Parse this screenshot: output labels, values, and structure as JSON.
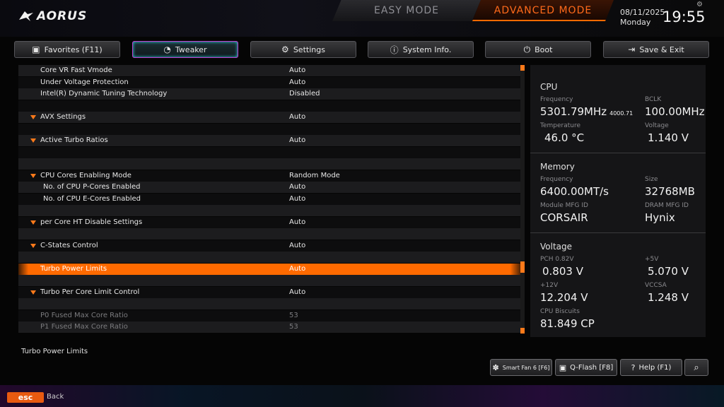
{
  "header": {
    "logo_text": "AORUS",
    "easy_mode": "EASY MODE",
    "advanced_mode": "ADVANCED MODE",
    "date": "08/11/2025",
    "day": "Monday",
    "time": "19:55"
  },
  "tabs": [
    {
      "label": "Favorites (F11)",
      "icon": "star-icon",
      "active": false
    },
    {
      "label": "Tweaker",
      "icon": "speedometer-icon",
      "active": true
    },
    {
      "label": "Settings",
      "icon": "gear-icon",
      "active": false
    },
    {
      "label": "System Info.",
      "icon": "info-icon",
      "active": false
    },
    {
      "label": "Boot",
      "icon": "power-icon",
      "active": false
    },
    {
      "label": "Save & Exit",
      "icon": "exit-icon",
      "active": false
    }
  ],
  "settings": [
    {
      "label": "Core VR Fast Vmode",
      "value": "Auto"
    },
    {
      "label": "Under Voltage Protection",
      "value": "Auto"
    },
    {
      "label": "Intel(R) Dynamic Tuning Technology",
      "value": "Disabled"
    },
    {
      "label": "",
      "value": ""
    },
    {
      "label": "AVX Settings",
      "value": "Auto",
      "expand": true
    },
    {
      "label": "",
      "value": ""
    },
    {
      "label": "Active Turbo Ratios",
      "value": "Auto",
      "expand": true
    },
    {
      "label": "",
      "value": ""
    },
    {
      "label": "",
      "value": ""
    },
    {
      "label": "CPU Cores Enabling Mode",
      "value": "Random Mode",
      "expand": true
    },
    {
      "label": "No. of CPU P-Cores Enabled",
      "value": "Auto",
      "indent": true
    },
    {
      "label": "No. of CPU E-Cores Enabled",
      "value": "Auto",
      "indent": true
    },
    {
      "label": "",
      "value": ""
    },
    {
      "label": "per Core HT Disable Settings",
      "value": "Auto",
      "expand": true
    },
    {
      "label": "",
      "value": ""
    },
    {
      "label": "C-States Control",
      "value": "Auto",
      "expand": true
    },
    {
      "label": "",
      "value": ""
    },
    {
      "label": "Turbo Power Limits",
      "value": "Auto",
      "selected": true
    },
    {
      "label": "",
      "value": ""
    },
    {
      "label": "Turbo Per Core Limit Control",
      "value": "Auto",
      "expand": true
    },
    {
      "label": "",
      "value": ""
    },
    {
      "label": "P0 Fused Max Core Ratio",
      "value": "53",
      "dim": true
    },
    {
      "label": "P1 Fused Max Core Ratio",
      "value": "53",
      "dim": true
    }
  ],
  "panel": {
    "cpu": {
      "title": "CPU",
      "freq_label": "Frequency",
      "freq_value": "5301.79MHz",
      "freq_sub": "4000.71",
      "bclk_label": "BCLK",
      "bclk_value": "100.00MHz",
      "temp_label": "Temperature",
      "temp_value": "46.0 °C",
      "volt_label": "Voltage",
      "volt_value": "1.140 V"
    },
    "memory": {
      "title": "Memory",
      "freq_label": "Frequency",
      "freq_value": "6400.00MT/s",
      "size_label": "Size",
      "size_value": "32768MB",
      "mfg_label": "Module MFG ID",
      "mfg_value": "CORSAIR",
      "dram_label": "DRAM MFG ID",
      "dram_value": "Hynix"
    },
    "voltage": {
      "title": "Voltage",
      "pch_label": "PCH 0.82V",
      "pch_value": "0.803 V",
      "p5_label": "+5V",
      "p5_value": "5.070 V",
      "p12_label": "+12V",
      "p12_value": "12.204 V",
      "vccsa_label": "VCCSA",
      "vccsa_value": "1.248 V",
      "bisc_label": "CPU Biscuits",
      "bisc_value": "81.849 CP"
    }
  },
  "description": "Turbo Power Limits",
  "bottom": {
    "smart_fan": "Smart Fan 6 [F6]",
    "qflash": "Q-Flash [F8]",
    "help": "Help (F1)",
    "esc": "esc",
    "back": "Back"
  },
  "colors": {
    "accent": "#ff6a00",
    "tab_active": "#2fd8e8"
  }
}
